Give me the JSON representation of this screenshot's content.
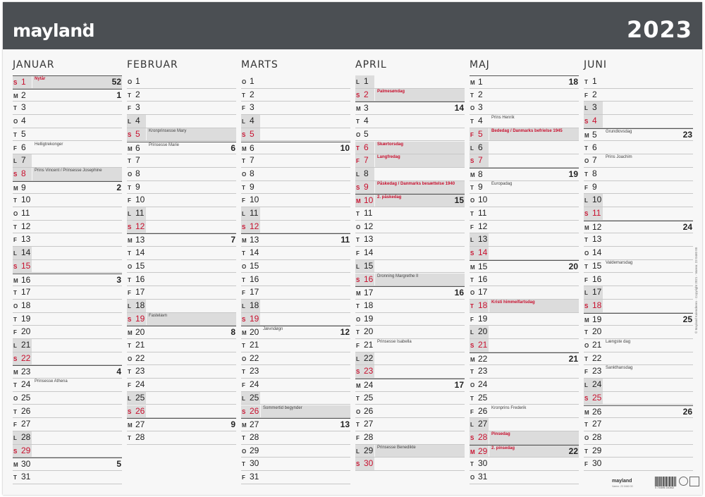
{
  "brand": "mayland",
  "brand_star": "*",
  "year": "2023",
  "months": [
    {
      "name": "JANUAR",
      "days": [
        {
          "wd": "S",
          "d": "1",
          "red": true,
          "we": true,
          "note": "Nytår",
          "nred": true,
          "wk": "52"
        },
        {
          "wd": "M",
          "d": "2",
          "wk": "1"
        },
        {
          "wd": "T",
          "d": "3"
        },
        {
          "wd": "O",
          "d": "4"
        },
        {
          "wd": "T",
          "d": "5"
        },
        {
          "wd": "F",
          "d": "6",
          "note": "Helligtrekonger"
        },
        {
          "wd": "L",
          "d": "7",
          "we": true
        },
        {
          "wd": "S",
          "d": "8",
          "red": true,
          "we": true,
          "note": "Prins Vincent / Prinsesse Josephine"
        },
        {
          "wd": "M",
          "d": "9",
          "wk": "2"
        },
        {
          "wd": "T",
          "d": "10"
        },
        {
          "wd": "O",
          "d": "11"
        },
        {
          "wd": "T",
          "d": "12"
        },
        {
          "wd": "F",
          "d": "13"
        },
        {
          "wd": "L",
          "d": "14",
          "we": true
        },
        {
          "wd": "S",
          "d": "15",
          "red": true,
          "we": true
        },
        {
          "wd": "M",
          "d": "16",
          "wk": "3"
        },
        {
          "wd": "T",
          "d": "17"
        },
        {
          "wd": "O",
          "d": "18"
        },
        {
          "wd": "T",
          "d": "19"
        },
        {
          "wd": "F",
          "d": "20"
        },
        {
          "wd": "L",
          "d": "21",
          "we": true
        },
        {
          "wd": "S",
          "d": "22",
          "red": true,
          "we": true
        },
        {
          "wd": "M",
          "d": "23",
          "wk": "4"
        },
        {
          "wd": "T",
          "d": "24",
          "note": "Prinsesse Athena"
        },
        {
          "wd": "O",
          "d": "25"
        },
        {
          "wd": "T",
          "d": "26"
        },
        {
          "wd": "F",
          "d": "27"
        },
        {
          "wd": "L",
          "d": "28",
          "we": true
        },
        {
          "wd": "S",
          "d": "29",
          "red": true,
          "we": true
        },
        {
          "wd": "M",
          "d": "30",
          "wk": "5"
        },
        {
          "wd": "T",
          "d": "31"
        }
      ]
    },
    {
      "name": "FEBRUAR",
      "days": [
        {
          "wd": "O",
          "d": "1"
        },
        {
          "wd": "T",
          "d": "2"
        },
        {
          "wd": "F",
          "d": "3"
        },
        {
          "wd": "L",
          "d": "4",
          "we": true
        },
        {
          "wd": "S",
          "d": "5",
          "red": true,
          "we": true,
          "note": "Kronprinsesse Mary"
        },
        {
          "wd": "M",
          "d": "6",
          "note": "Prinsesse Marie",
          "wk": "6"
        },
        {
          "wd": "T",
          "d": "7"
        },
        {
          "wd": "O",
          "d": "8"
        },
        {
          "wd": "T",
          "d": "9"
        },
        {
          "wd": "F",
          "d": "10"
        },
        {
          "wd": "L",
          "d": "11",
          "we": true
        },
        {
          "wd": "S",
          "d": "12",
          "red": true,
          "we": true
        },
        {
          "wd": "M",
          "d": "13",
          "wk": "7"
        },
        {
          "wd": "T",
          "d": "14"
        },
        {
          "wd": "O",
          "d": "15"
        },
        {
          "wd": "T",
          "d": "16"
        },
        {
          "wd": "F",
          "d": "17"
        },
        {
          "wd": "L",
          "d": "18",
          "we": true
        },
        {
          "wd": "S",
          "d": "19",
          "red": true,
          "we": true,
          "note": "Fastelavn"
        },
        {
          "wd": "M",
          "d": "20",
          "wk": "8"
        },
        {
          "wd": "T",
          "d": "21"
        },
        {
          "wd": "O",
          "d": "22"
        },
        {
          "wd": "T",
          "d": "23"
        },
        {
          "wd": "F",
          "d": "24"
        },
        {
          "wd": "L",
          "d": "25",
          "we": true
        },
        {
          "wd": "S",
          "d": "26",
          "red": true,
          "we": true
        },
        {
          "wd": "M",
          "d": "27",
          "wk": "9"
        },
        {
          "wd": "T",
          "d": "28"
        }
      ]
    },
    {
      "name": "MARTS",
      "days": [
        {
          "wd": "O",
          "d": "1"
        },
        {
          "wd": "T",
          "d": "2"
        },
        {
          "wd": "F",
          "d": "3"
        },
        {
          "wd": "L",
          "d": "4",
          "we": true
        },
        {
          "wd": "S",
          "d": "5",
          "red": true,
          "we": true
        },
        {
          "wd": "M",
          "d": "6",
          "wk": "10"
        },
        {
          "wd": "T",
          "d": "7"
        },
        {
          "wd": "O",
          "d": "8"
        },
        {
          "wd": "T",
          "d": "9"
        },
        {
          "wd": "F",
          "d": "10"
        },
        {
          "wd": "L",
          "d": "11",
          "we": true
        },
        {
          "wd": "S",
          "d": "12",
          "red": true,
          "we": true
        },
        {
          "wd": "M",
          "d": "13",
          "wk": "11"
        },
        {
          "wd": "T",
          "d": "14"
        },
        {
          "wd": "O",
          "d": "15"
        },
        {
          "wd": "T",
          "d": "16"
        },
        {
          "wd": "F",
          "d": "17"
        },
        {
          "wd": "L",
          "d": "18",
          "we": true
        },
        {
          "wd": "S",
          "d": "19",
          "red": true,
          "we": true
        },
        {
          "wd": "M",
          "d": "20",
          "note": "Jævndøgn",
          "wk": "12"
        },
        {
          "wd": "T",
          "d": "21"
        },
        {
          "wd": "O",
          "d": "22"
        },
        {
          "wd": "T",
          "d": "23"
        },
        {
          "wd": "F",
          "d": "24"
        },
        {
          "wd": "L",
          "d": "25",
          "we": true
        },
        {
          "wd": "S",
          "d": "26",
          "red": true,
          "we": true,
          "note": "Sommertid begynder"
        },
        {
          "wd": "M",
          "d": "27",
          "wk": "13"
        },
        {
          "wd": "T",
          "d": "28"
        },
        {
          "wd": "O",
          "d": "29"
        },
        {
          "wd": "T",
          "d": "30"
        },
        {
          "wd": "F",
          "d": "31"
        }
      ]
    },
    {
      "name": "APRIL",
      "days": [
        {
          "wd": "L",
          "d": "1",
          "we": true
        },
        {
          "wd": "S",
          "d": "2",
          "red": true,
          "we": true,
          "note": "Palmesøndag",
          "nred": true
        },
        {
          "wd": "M",
          "d": "3",
          "wk": "14"
        },
        {
          "wd": "T",
          "d": "4"
        },
        {
          "wd": "O",
          "d": "5"
        },
        {
          "wd": "T",
          "d": "6",
          "red": true,
          "we": true,
          "note": "Skærtorsdag",
          "nred": true
        },
        {
          "wd": "F",
          "d": "7",
          "red": true,
          "we": true,
          "note": "Langfredag",
          "nred": true
        },
        {
          "wd": "L",
          "d": "8",
          "we": true
        },
        {
          "wd": "S",
          "d": "9",
          "red": true,
          "we": true,
          "note": "Påskedag / Danmarks besættelse 1940",
          "nred": true
        },
        {
          "wd": "M",
          "d": "10",
          "red": true,
          "we": true,
          "note": "2. påskedag",
          "nred": true,
          "wk": "15"
        },
        {
          "wd": "T",
          "d": "11"
        },
        {
          "wd": "O",
          "d": "12"
        },
        {
          "wd": "T",
          "d": "13"
        },
        {
          "wd": "F",
          "d": "14"
        },
        {
          "wd": "L",
          "d": "15",
          "we": true
        },
        {
          "wd": "S",
          "d": "16",
          "red": true,
          "we": true,
          "note": "Dronning Margrethe II"
        },
        {
          "wd": "M",
          "d": "17",
          "wk": "16"
        },
        {
          "wd": "T",
          "d": "18"
        },
        {
          "wd": "O",
          "d": "19"
        },
        {
          "wd": "T",
          "d": "20"
        },
        {
          "wd": "F",
          "d": "21",
          "note": "Prinsesse Isabella"
        },
        {
          "wd": "L",
          "d": "22",
          "we": true
        },
        {
          "wd": "S",
          "d": "23",
          "red": true,
          "we": true
        },
        {
          "wd": "M",
          "d": "24",
          "wk": "17"
        },
        {
          "wd": "T",
          "d": "25"
        },
        {
          "wd": "O",
          "d": "26"
        },
        {
          "wd": "T",
          "d": "27"
        },
        {
          "wd": "F",
          "d": "28"
        },
        {
          "wd": "L",
          "d": "29",
          "we": true,
          "note": "Prinsesse Benedikte"
        },
        {
          "wd": "S",
          "d": "30",
          "red": true,
          "we": true
        }
      ]
    },
    {
      "name": "MAJ",
      "days": [
        {
          "wd": "M",
          "d": "1",
          "wk": "18"
        },
        {
          "wd": "T",
          "d": "2"
        },
        {
          "wd": "O",
          "d": "3"
        },
        {
          "wd": "T",
          "d": "4",
          "note": "Prins Henrik"
        },
        {
          "wd": "F",
          "d": "5",
          "red": true,
          "we": true,
          "note": "Bededag / Danmarks befrielse 1945",
          "nred": true
        },
        {
          "wd": "L",
          "d": "6",
          "we": true
        },
        {
          "wd": "S",
          "d": "7",
          "red": true,
          "we": true
        },
        {
          "wd": "M",
          "d": "8",
          "wk": "19"
        },
        {
          "wd": "T",
          "d": "9",
          "note": "Europadag"
        },
        {
          "wd": "O",
          "d": "10"
        },
        {
          "wd": "T",
          "d": "11"
        },
        {
          "wd": "F",
          "d": "12"
        },
        {
          "wd": "L",
          "d": "13",
          "we": true
        },
        {
          "wd": "S",
          "d": "14",
          "red": true,
          "we": true
        },
        {
          "wd": "M",
          "d": "15",
          "wk": "20"
        },
        {
          "wd": "T",
          "d": "16"
        },
        {
          "wd": "O",
          "d": "17"
        },
        {
          "wd": "T",
          "d": "18",
          "red": true,
          "we": true,
          "note": "Kristi himmelfartsdag",
          "nred": true
        },
        {
          "wd": "F",
          "d": "19"
        },
        {
          "wd": "L",
          "d": "20",
          "we": true
        },
        {
          "wd": "S",
          "d": "21",
          "red": true,
          "we": true
        },
        {
          "wd": "M",
          "d": "22",
          "wk": "21"
        },
        {
          "wd": "T",
          "d": "23"
        },
        {
          "wd": "O",
          "d": "24"
        },
        {
          "wd": "T",
          "d": "25"
        },
        {
          "wd": "F",
          "d": "26",
          "note": "Kronprins Frederik"
        },
        {
          "wd": "L",
          "d": "27",
          "we": true
        },
        {
          "wd": "S",
          "d": "28",
          "red": true,
          "we": true,
          "note": "Pinsedag",
          "nred": true
        },
        {
          "wd": "M",
          "d": "29",
          "red": true,
          "we": true,
          "note": "2. pinsedag",
          "nred": true,
          "wk": "22"
        },
        {
          "wd": "T",
          "d": "30"
        },
        {
          "wd": "O",
          "d": "31"
        }
      ]
    },
    {
      "name": "JUNI",
      "days": [
        {
          "wd": "T",
          "d": "1"
        },
        {
          "wd": "F",
          "d": "2"
        },
        {
          "wd": "L",
          "d": "3",
          "we": true
        },
        {
          "wd": "S",
          "d": "4",
          "red": true,
          "we": true
        },
        {
          "wd": "M",
          "d": "5",
          "note": "Grundlovsdag",
          "wk": "23"
        },
        {
          "wd": "T",
          "d": "6"
        },
        {
          "wd": "O",
          "d": "7",
          "note": "Prins Joachim"
        },
        {
          "wd": "T",
          "d": "8"
        },
        {
          "wd": "F",
          "d": "9"
        },
        {
          "wd": "L",
          "d": "10",
          "we": true
        },
        {
          "wd": "S",
          "d": "11",
          "red": true,
          "we": true
        },
        {
          "wd": "M",
          "d": "12",
          "wk": "24"
        },
        {
          "wd": "T",
          "d": "13"
        },
        {
          "wd": "O",
          "d": "14"
        },
        {
          "wd": "T",
          "d": "15",
          "note": "Valdemarsdag"
        },
        {
          "wd": "F",
          "d": "16"
        },
        {
          "wd": "L",
          "d": "17",
          "we": true
        },
        {
          "wd": "S",
          "d": "18",
          "red": true,
          "we": true
        },
        {
          "wd": "M",
          "d": "19",
          "wk": "25"
        },
        {
          "wd": "T",
          "d": "20"
        },
        {
          "wd": "O",
          "d": "21",
          "note": "Længste dag"
        },
        {
          "wd": "T",
          "d": "22"
        },
        {
          "wd": "F",
          "d": "23",
          "note": "Sankthansdag"
        },
        {
          "wd": "L",
          "d": "24",
          "we": true
        },
        {
          "wd": "S",
          "d": "25",
          "red": true,
          "we": true
        },
        {
          "wd": "M",
          "d": "26",
          "wk": "26"
        },
        {
          "wd": "T",
          "d": "27"
        },
        {
          "wd": "O",
          "d": "28"
        },
        {
          "wd": "T",
          "d": "29"
        },
        {
          "wd": "F",
          "d": "30"
        }
      ]
    }
  ],
  "side_text": "© Mayland Kalenderen · Copyright 2021 · Varenr. 23 0460 00",
  "footer": {
    "logo": "mayland",
    "sub": "Varenr. 23 0460 00",
    "barcode_num": "5 704896 160462"
  },
  "colors": {
    "header": "#4b4f53",
    "accent_red": "#c8102e",
    "weekend_fill": "#dcdcdc"
  }
}
